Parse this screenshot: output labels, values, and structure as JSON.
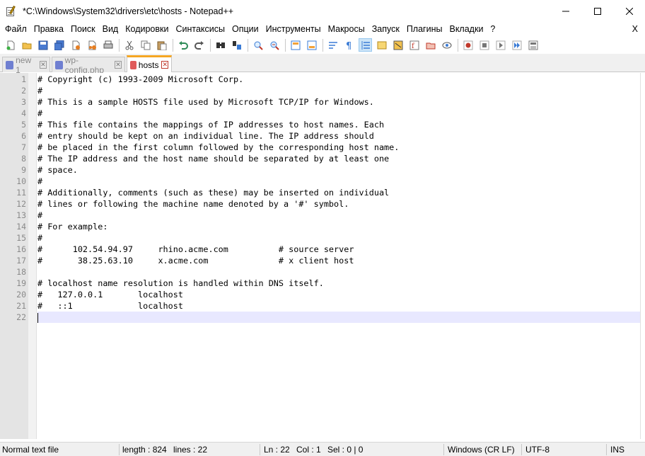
{
  "window": {
    "title": "*C:\\Windows\\System32\\drivers\\etc\\hosts - Notepad++"
  },
  "menu": {
    "items": [
      "Файл",
      "Правка",
      "Поиск",
      "Вид",
      "Кодировки",
      "Синтаксисы",
      "Опции",
      "Инструменты",
      "Макросы",
      "Запуск",
      "Плагины",
      "Вкладки",
      "?"
    ],
    "close_label": "X"
  },
  "toolbar": {
    "buttons": [
      "new-file-icon",
      "open-file-icon",
      "save-icon",
      "save-all-icon",
      "close-icon",
      "close-all-icon",
      "print-icon",
      "cut-icon",
      "copy-icon",
      "paste-icon",
      "undo-icon",
      "redo-icon",
      "find-icon",
      "replace-icon",
      "zoom-in-icon",
      "zoom-out-icon",
      "sync-vertical-icon",
      "sync-horizontal-icon",
      "word-wrap-icon",
      "show-all-chars-icon",
      "indent-guide-icon",
      "user-language-icon",
      "doc-map-icon",
      "function-list-icon",
      "folder-workspace-icon",
      "monitoring-icon",
      "record-macro-icon",
      "stop-macro-icon",
      "play-macro-icon",
      "run-macro-multiple-icon",
      "save-macro-icon"
    ]
  },
  "tabs": [
    {
      "label": "new 1",
      "active": false,
      "icon_color": "#6f7fd1"
    },
    {
      "label": "wp-config.php",
      "active": false,
      "icon_color": "#6f7fd1"
    },
    {
      "label": "hosts",
      "active": true,
      "icon_color": "#e05a5a"
    }
  ],
  "tab_close_glyph": "✕",
  "editor": {
    "lines": [
      "# Copyright (c) 1993-2009 Microsoft Corp.",
      "#",
      "# This is a sample HOSTS file used by Microsoft TCP/IP for Windows.",
      "#",
      "# This file contains the mappings of IP addresses to host names. Each",
      "# entry should be kept on an individual line. The IP address should",
      "# be placed in the first column followed by the corresponding host name.",
      "# The IP address and the host name should be separated by at least one",
      "# space.",
      "#",
      "# Additionally, comments (such as these) may be inserted on individual",
      "# lines or following the machine name denoted by a '#' symbol.",
      "#",
      "# For example:",
      "#",
      "#      102.54.94.97     rhino.acme.com          # source server",
      "#       38.25.63.10     x.acme.com              # x client host",
      "",
      "# localhost name resolution is handled within DNS itself.",
      "#   127.0.0.1       localhost",
      "#   ::1             localhost",
      ""
    ],
    "line_numbers": [
      "1",
      "2",
      "3",
      "4",
      "5",
      "6",
      "7",
      "8",
      "9",
      "10",
      "11",
      "12",
      "13",
      "14",
      "15",
      "16",
      "17",
      "18",
      "19",
      "20",
      "21",
      "22"
    ],
    "current_line": 22
  },
  "status": {
    "file_type": "Normal text file",
    "length": "length : 824",
    "lines": "lines : 22",
    "ln": "Ln : 22",
    "col": "Col : 1",
    "sel": "Sel : 0 | 0",
    "eol": "Windows (CR LF)",
    "encoding": "UTF-8",
    "mode": "INS"
  }
}
